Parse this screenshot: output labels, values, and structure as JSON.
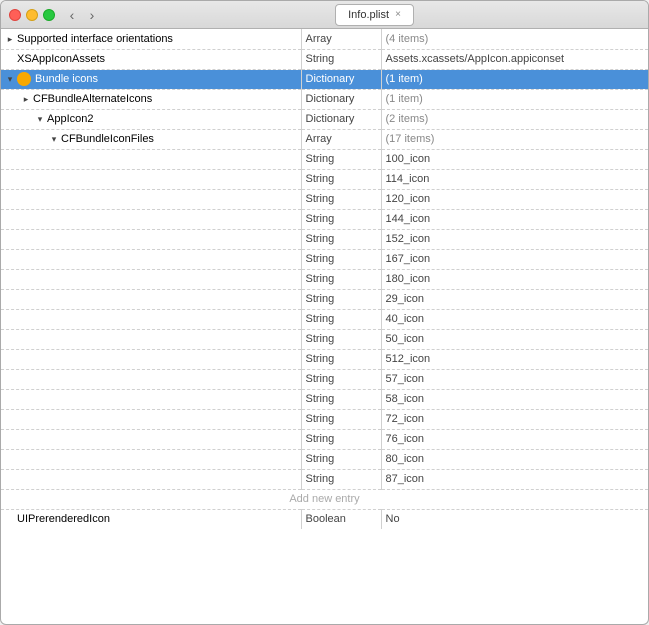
{
  "window": {
    "title": "Info.plist"
  },
  "toolbar": {
    "back_label": "‹",
    "forward_label": "›",
    "close_label": "×"
  },
  "rows": [
    {
      "id": "supported-interface",
      "indent": 0,
      "triangle": "closed",
      "key": "Supported interface orientations",
      "type": "Array",
      "value": "(4 items)",
      "value_class": "meta-value",
      "selected": false
    },
    {
      "id": "xsappicon",
      "indent": 0,
      "triangle": "leaf",
      "key": "XSAppIconAssets",
      "type": "String",
      "value": "Assets.xcassets/AppIcon.appiconset",
      "value_class": "string-value",
      "selected": false
    },
    {
      "id": "bundle-icons",
      "indent": 0,
      "triangle": "open",
      "key": "Bundle icons",
      "type": "Dictionary",
      "value": "(1 item)",
      "value_class": "meta-value",
      "selected": true,
      "has_badge": true
    },
    {
      "id": "cfbundle-alternate",
      "indent": 1,
      "triangle": "closed",
      "key": "CFBundleAlternateIcons",
      "type": "Dictionary",
      "value": "(1 item)",
      "value_class": "meta-value",
      "selected": false
    },
    {
      "id": "appicon2",
      "indent": 2,
      "triangle": "open",
      "key": "AppIcon2",
      "type": "Dictionary",
      "value": "(2 items)",
      "value_class": "meta-value",
      "selected": false
    },
    {
      "id": "cfbundle-icon-files",
      "indent": 3,
      "triangle": "open",
      "key": "CFBundleIconFiles",
      "type": "Array",
      "value": "(17 items)",
      "value_class": "meta-value",
      "selected": false
    },
    {
      "id": "icon-100",
      "indent": 4,
      "triangle": "leaf",
      "key": "",
      "type": "String",
      "value": "100_icon",
      "value_class": "string-value",
      "selected": false
    },
    {
      "id": "icon-114",
      "indent": 4,
      "triangle": "leaf",
      "key": "",
      "type": "String",
      "value": "114_icon",
      "value_class": "string-value",
      "selected": false
    },
    {
      "id": "icon-120",
      "indent": 4,
      "triangle": "leaf",
      "key": "",
      "type": "String",
      "value": "120_icon",
      "value_class": "string-value",
      "selected": false
    },
    {
      "id": "icon-144",
      "indent": 4,
      "triangle": "leaf",
      "key": "",
      "type": "String",
      "value": "144_icon",
      "value_class": "string-value",
      "selected": false
    },
    {
      "id": "icon-152",
      "indent": 4,
      "triangle": "leaf",
      "key": "",
      "type": "String",
      "value": "152_icon",
      "value_class": "string-value",
      "selected": false
    },
    {
      "id": "icon-167",
      "indent": 4,
      "triangle": "leaf",
      "key": "",
      "type": "String",
      "value": "167_icon",
      "value_class": "string-value",
      "selected": false
    },
    {
      "id": "icon-180",
      "indent": 4,
      "triangle": "leaf",
      "key": "",
      "type": "String",
      "value": "180_icon",
      "value_class": "string-value",
      "selected": false
    },
    {
      "id": "icon-29",
      "indent": 4,
      "triangle": "leaf",
      "key": "",
      "type": "String",
      "value": "29_icon",
      "value_class": "string-value",
      "selected": false
    },
    {
      "id": "icon-40",
      "indent": 4,
      "triangle": "leaf",
      "key": "",
      "type": "String",
      "value": "40_icon",
      "value_class": "string-value",
      "selected": false
    },
    {
      "id": "icon-50",
      "indent": 4,
      "triangle": "leaf",
      "key": "",
      "type": "String",
      "value": "50_icon",
      "value_class": "string-value",
      "selected": false
    },
    {
      "id": "icon-512",
      "indent": 4,
      "triangle": "leaf",
      "key": "",
      "type": "String",
      "value": "512_icon",
      "value_class": "string-value",
      "selected": false
    },
    {
      "id": "icon-57",
      "indent": 4,
      "triangle": "leaf",
      "key": "",
      "type": "String",
      "value": "57_icon",
      "value_class": "string-value",
      "selected": false
    },
    {
      "id": "icon-58",
      "indent": 4,
      "triangle": "leaf",
      "key": "",
      "type": "String",
      "value": "58_icon",
      "value_class": "string-value",
      "selected": false
    },
    {
      "id": "icon-72",
      "indent": 4,
      "triangle": "leaf",
      "key": "",
      "type": "String",
      "value": "72_icon",
      "value_class": "string-value",
      "selected": false
    },
    {
      "id": "icon-76",
      "indent": 4,
      "triangle": "leaf",
      "key": "",
      "type": "String",
      "value": "76_icon",
      "value_class": "string-value",
      "selected": false
    },
    {
      "id": "icon-80",
      "indent": 4,
      "triangle": "leaf",
      "key": "",
      "type": "String",
      "value": "80_icon",
      "value_class": "string-value",
      "selected": false
    },
    {
      "id": "icon-87",
      "indent": 4,
      "triangle": "leaf",
      "key": "",
      "type": "String",
      "value": "87_icon",
      "value_class": "string-value",
      "selected": false
    },
    {
      "id": "add-entry",
      "isAddEntry": true
    },
    {
      "id": "ui-prerendered",
      "indent": 0,
      "triangle": "leaf",
      "key": "UIPrerenderedIcon",
      "type": "Boolean",
      "value": "No",
      "value_class": "bool-value",
      "selected": false
    }
  ]
}
